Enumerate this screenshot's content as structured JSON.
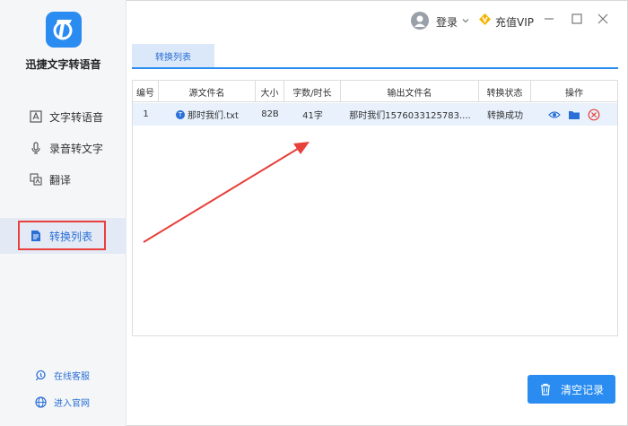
{
  "app": {
    "name": "迅捷文字转语音",
    "brand_color": "#2a8cf0"
  },
  "sidebar": {
    "items": [
      {
        "label": "文字转语音",
        "icon": "text-document-icon"
      },
      {
        "label": "录音转文字",
        "icon": "microphone-icon"
      },
      {
        "label": "翻译",
        "icon": "translate-icon"
      },
      {
        "label": "转换列表",
        "icon": "convert-list-icon",
        "active": true
      }
    ],
    "bottom": [
      {
        "label": "在线客服",
        "icon": "headset-icon"
      },
      {
        "label": "进入官网",
        "icon": "globe-icon"
      }
    ]
  },
  "header": {
    "login": "登录",
    "vip": "充值VIP"
  },
  "tabs": [
    {
      "label": "转换列表",
      "active": true
    }
  ],
  "table": {
    "headers": [
      "编号",
      "源文件名",
      "大小",
      "字数/时长",
      "输出文件名",
      "转换状态",
      "操作"
    ],
    "rows": [
      {
        "id": "1",
        "source": "那时我们.txt",
        "size": "82B",
        "length": "41字",
        "output": "那时我们1576033125783....",
        "status": "转换成功"
      }
    ]
  },
  "actions": {
    "clear": "清空记录"
  },
  "annotation_color": "#e8403a"
}
